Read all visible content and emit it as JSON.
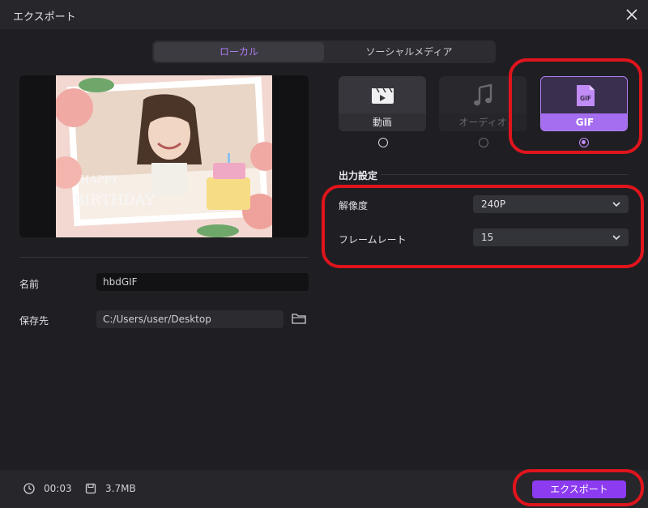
{
  "window": {
    "title": "エクスポート"
  },
  "tabs": {
    "local": "ローカル",
    "social": "ソーシャルメディア"
  },
  "form": {
    "name_label": "名前",
    "name_value": "hbdGIF",
    "path_label": "保存先",
    "path_value": "C:/Users/user/Desktop"
  },
  "formats": [
    {
      "label": "動画",
      "icon": "clapperboard-icon",
      "selected": false
    },
    {
      "label": "オーディオ",
      "icon": "music-note-icon",
      "selected": false
    },
    {
      "label": "GIF",
      "icon": "gif-file-icon",
      "selected": true
    }
  ],
  "output": {
    "section_title": "出力設定",
    "resolution_label": "解像度",
    "resolution_value": "240P",
    "framerate_label": "フレームレート",
    "framerate_value": "15"
  },
  "footer": {
    "duration": "00:03",
    "size": "3.7MB",
    "export_label": "エクスポート"
  },
  "colors": {
    "accent": "#a56ef0",
    "export_button": "#8c3bf0",
    "highlight": "#e0141c"
  }
}
